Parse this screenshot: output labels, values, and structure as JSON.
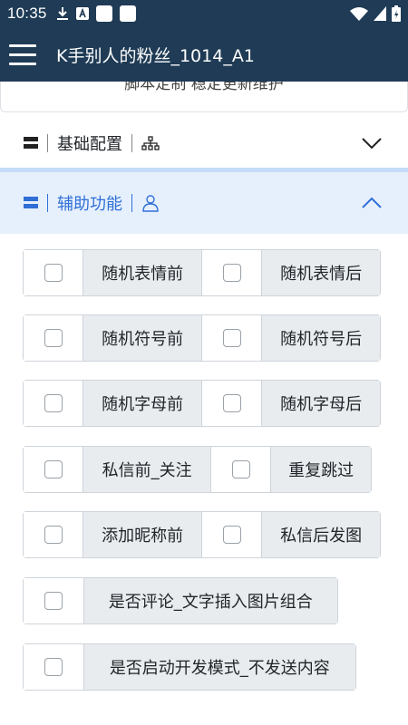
{
  "status_bar": {
    "time": "10:35",
    "icons": [
      "download-icon",
      "text-a-icon",
      "app-square-icon",
      "app-square-icon",
      "wifi-icon",
      "signal-icon",
      "battery-icon"
    ]
  },
  "app_bar": {
    "title": "K手别人的粉丝_1014_A1"
  },
  "cut_card_text": "脚本定制 稳定更新维护",
  "sections": {
    "basic": {
      "label": "基础配置",
      "expanded": false
    },
    "assist": {
      "label": "辅助功能",
      "expanded": true
    }
  },
  "options": [
    {
      "label": "随机表情前",
      "checked": false
    },
    {
      "label": "随机表情后",
      "checked": false
    },
    {
      "label": "随机符号前",
      "checked": false
    },
    {
      "label": "随机符号后",
      "checked": false
    },
    {
      "label": "随机字母前",
      "checked": false
    },
    {
      "label": "随机字母后",
      "checked": false
    },
    {
      "label": "私信前_关注",
      "checked": false
    },
    {
      "label": "重复跳过",
      "checked": false
    },
    {
      "label": "添加昵称前",
      "checked": false
    },
    {
      "label": "私信后发图",
      "checked": false
    },
    {
      "label": "是否评论_文字插入图片组合",
      "checked": false
    },
    {
      "label": "是否启动开发模式_不发送内容",
      "checked": false
    }
  ],
  "colors": {
    "appbar": "#1f3b55",
    "accent": "#2f6fd6",
    "section_active_bg": "#e6f0fd",
    "label_bg": "#e9ecef"
  }
}
